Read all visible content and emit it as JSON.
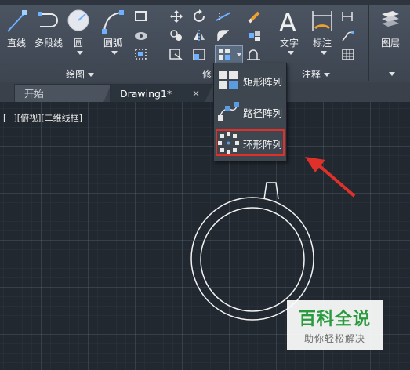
{
  "ribbon": {
    "draw_tools": [
      "直线",
      "多段线",
      "圆",
      "圆弧"
    ],
    "annotation_tools": [
      "文字",
      "标注"
    ],
    "layers_tool": "图层",
    "panels": {
      "draw": "绘图",
      "modify": "修",
      "annotation": "注释"
    }
  },
  "tabs": [
    {
      "label": "开始"
    },
    {
      "label": "Drawing1*",
      "close": "×"
    }
  ],
  "viewport_label": "[−][俯视][二维线框]",
  "array_menu": {
    "items": [
      "矩形阵列",
      "路径阵列",
      "环形阵列"
    ],
    "highlighted_index": 2
  },
  "watermark": {
    "title": "百科全说",
    "subtitle": "助你轻松解决"
  },
  "colors": {
    "accent_blue": "#4a8fd8",
    "highlight_red": "#e0302a",
    "watermark_green": "#2a9a3e"
  }
}
